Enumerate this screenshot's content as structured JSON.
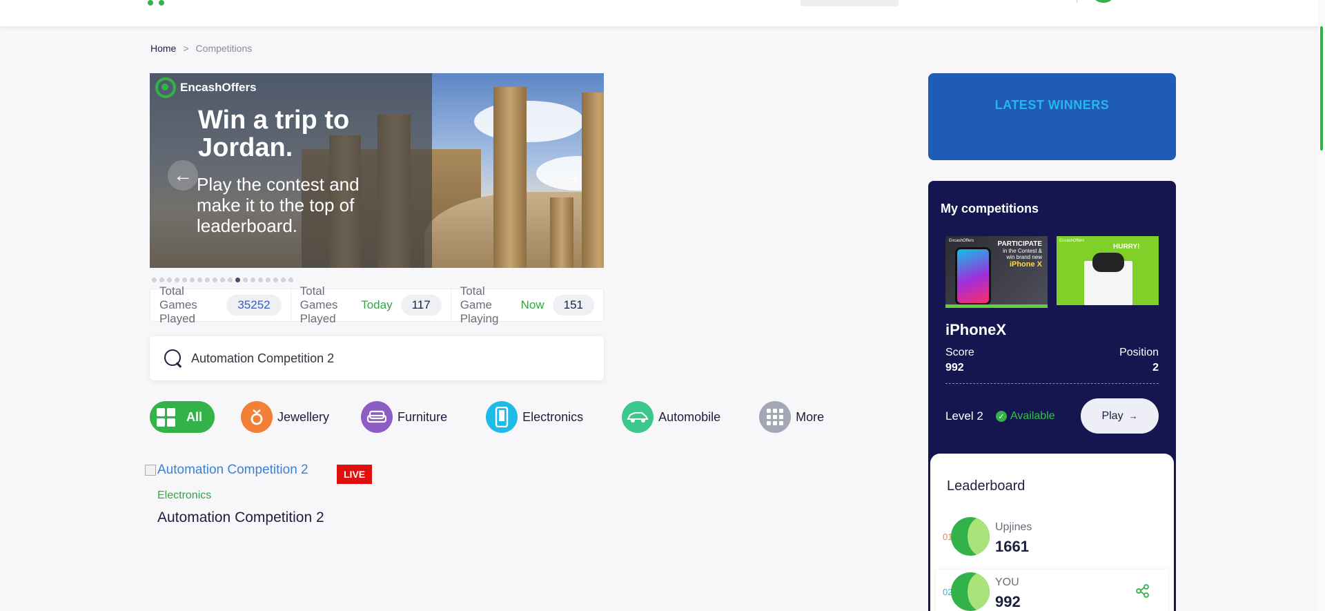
{
  "breadcrumb": {
    "home": "Home",
    "separator": ">",
    "current": "Competitions"
  },
  "banner": {
    "brand": "EncashOffers",
    "headline": "Win a trip to Jordan.",
    "subline": "Play the contest and make it to the top of leaderboard.",
    "prev_icon": "arrow-left-icon",
    "next_icon": "arrow-right-icon",
    "slide_count": 19,
    "active_slide": 11
  },
  "stats": {
    "total_label": "Total Games Played",
    "total_value": "35252",
    "today_label": "Total Games Played",
    "today_tag": "Today",
    "today_value": "117",
    "now_label": "Total Game Playing",
    "now_tag": "Now",
    "now_value": "151"
  },
  "search": {
    "value": "Automation Competition 2"
  },
  "categories": [
    {
      "label": "All",
      "color": "#33b24a"
    },
    {
      "label": "Jewellery",
      "color": "#f47f36"
    },
    {
      "label": "Furniture",
      "color": "#8e5dc3"
    },
    {
      "label": "Electronics",
      "color": "#1ebbe6"
    },
    {
      "label": "Automobile",
      "color": "#3cc88c"
    },
    {
      "label": "More",
      "color": "#a3a6b4"
    }
  ],
  "competition": {
    "image_alt": "Automation Competition 2",
    "badge": "LIVE",
    "category": "Electronics",
    "title": "Automation Competition 2"
  },
  "latest_winners": {
    "label": "LATEST WINNERS"
  },
  "my_competitions": {
    "title": "My competitions",
    "thumb1": {
      "brand": "EncashOffers",
      "head": "PARTICIPATE",
      "sub": "in the Contest & win brand new",
      "product": "iPhone X"
    },
    "thumb2": {
      "brand": "EncashOffers",
      "head": "HURRY!"
    },
    "name": "iPhoneX",
    "score_label": "Score",
    "score_value": "992",
    "position_label": "Position",
    "position_value": "2",
    "level": "Level 2",
    "status": "Available",
    "play_label": "Play"
  },
  "leaderboard": {
    "title": "Leaderboard",
    "rows": [
      {
        "rank": "01",
        "name": "Upjines",
        "score": "1661",
        "rank_color": "#f47f36"
      },
      {
        "rank": "02",
        "name": "YOU",
        "score": "992",
        "rank_color": "#1ebbe6"
      }
    ]
  }
}
